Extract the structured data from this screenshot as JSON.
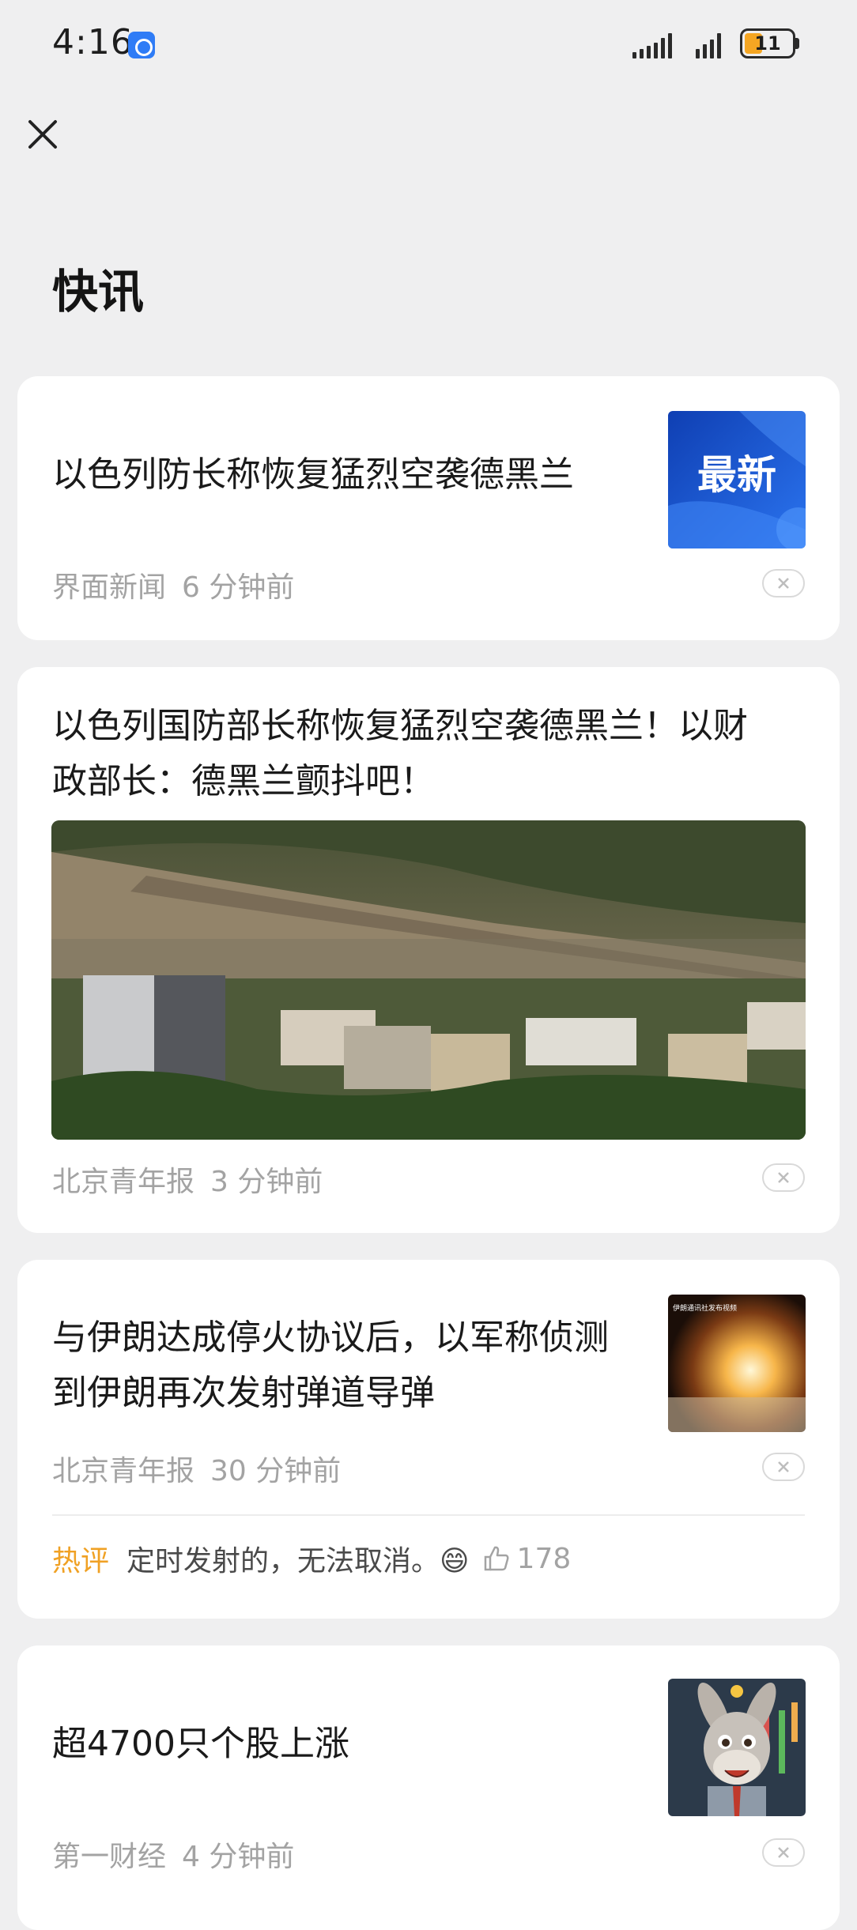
{
  "status_bar": {
    "time": "4:16",
    "battery": "11",
    "icons": [
      "app-badge-icon",
      "signal-icon",
      "signal-icon",
      "battery-icon"
    ],
    "battery_color": "#f5a623"
  },
  "header": {
    "close_icon": "close-icon",
    "title": "快讯"
  },
  "feed": [
    {
      "headline": "以色列防长称恢复猛烈空袭德黑兰",
      "source": "界面新闻",
      "time": "6 分钟前",
      "thumb_text": "最新",
      "thumb_color": "#1f5fd8"
    },
    {
      "headline_line1": "以色列国防部长称恢复猛烈空袭德黑兰！以财",
      "headline_line2": "政部长：德黑兰颤抖吧！",
      "source": "北京青年报",
      "time": "3 分钟前"
    },
    {
      "headline_line1": "与伊朗达成停火协议后，以军称侦测",
      "headline_line2": "到伊朗再次发射弹道导弹",
      "source": "北京青年报",
      "time": "30 分钟前",
      "thumb_caption": "伊朗通讯社发布视频",
      "hot_label": "热评",
      "hot_text": "定时发射的，无法取消。😄",
      "likes": "178"
    },
    {
      "headline": "超4700只个股上涨",
      "source": "第一财经",
      "time": "4 分钟前"
    }
  ],
  "accent_color": "#f0a124"
}
